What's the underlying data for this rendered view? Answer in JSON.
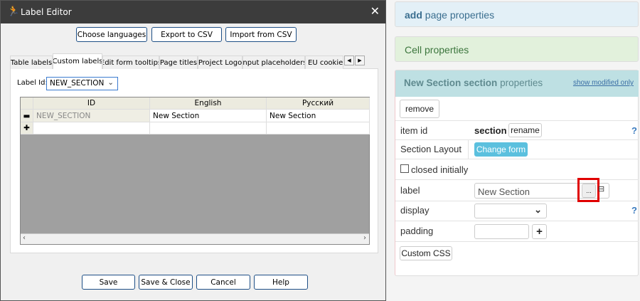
{
  "dialog": {
    "title": "Label Editor",
    "buttons": {
      "choose": "Choose languages",
      "export": "Export to CSV",
      "import": "Import from CSV"
    },
    "tabs": [
      "Table labels",
      "Custom labels",
      "Edit form tooltips",
      "Page titles",
      "Project Logo",
      "Input placeholders",
      "EU cookie b"
    ],
    "active_tab": "Custom labels",
    "label_id_label": "Label Id:",
    "label_id_value": "NEW_SECTION",
    "grid": {
      "columns": [
        "ID",
        "English",
        "Русский"
      ],
      "rows": [
        [
          "NEW_SECTION",
          "New Section",
          "New Section"
        ]
      ]
    },
    "footer": {
      "save": "Save",
      "save_close": "Save & Close",
      "cancel": "Cancel",
      "help": "Help"
    }
  },
  "right": {
    "add_page": {
      "bold": "add",
      "rest": "page properties"
    },
    "cell_props": "Cell properties",
    "section": {
      "title_bold": "New Section section",
      "title_rest": "properties",
      "show_modified": "show modified only",
      "remove": "remove",
      "item_id_label": "item id",
      "item_id_value": "section",
      "rename": "rename",
      "layout_label": "Section Layout",
      "change_form": "Change form",
      "closed_label": "closed initially",
      "closed_checked": false,
      "label_label": "label",
      "label_value": "New Section",
      "ellipsis": "...",
      "display_label": "display",
      "display_value": "",
      "padding_label": "padding",
      "padding_value": "",
      "custom_css": "Custom CSS",
      "help": "?"
    }
  },
  "colors": {
    "titlebar": "#3c3c3c",
    "highlight": "#e00000",
    "change_form": "#5bc0de",
    "section_header": "#bee0e3",
    "cell_header": "#e2f1dc",
    "page_header": "#e3f0f7"
  }
}
